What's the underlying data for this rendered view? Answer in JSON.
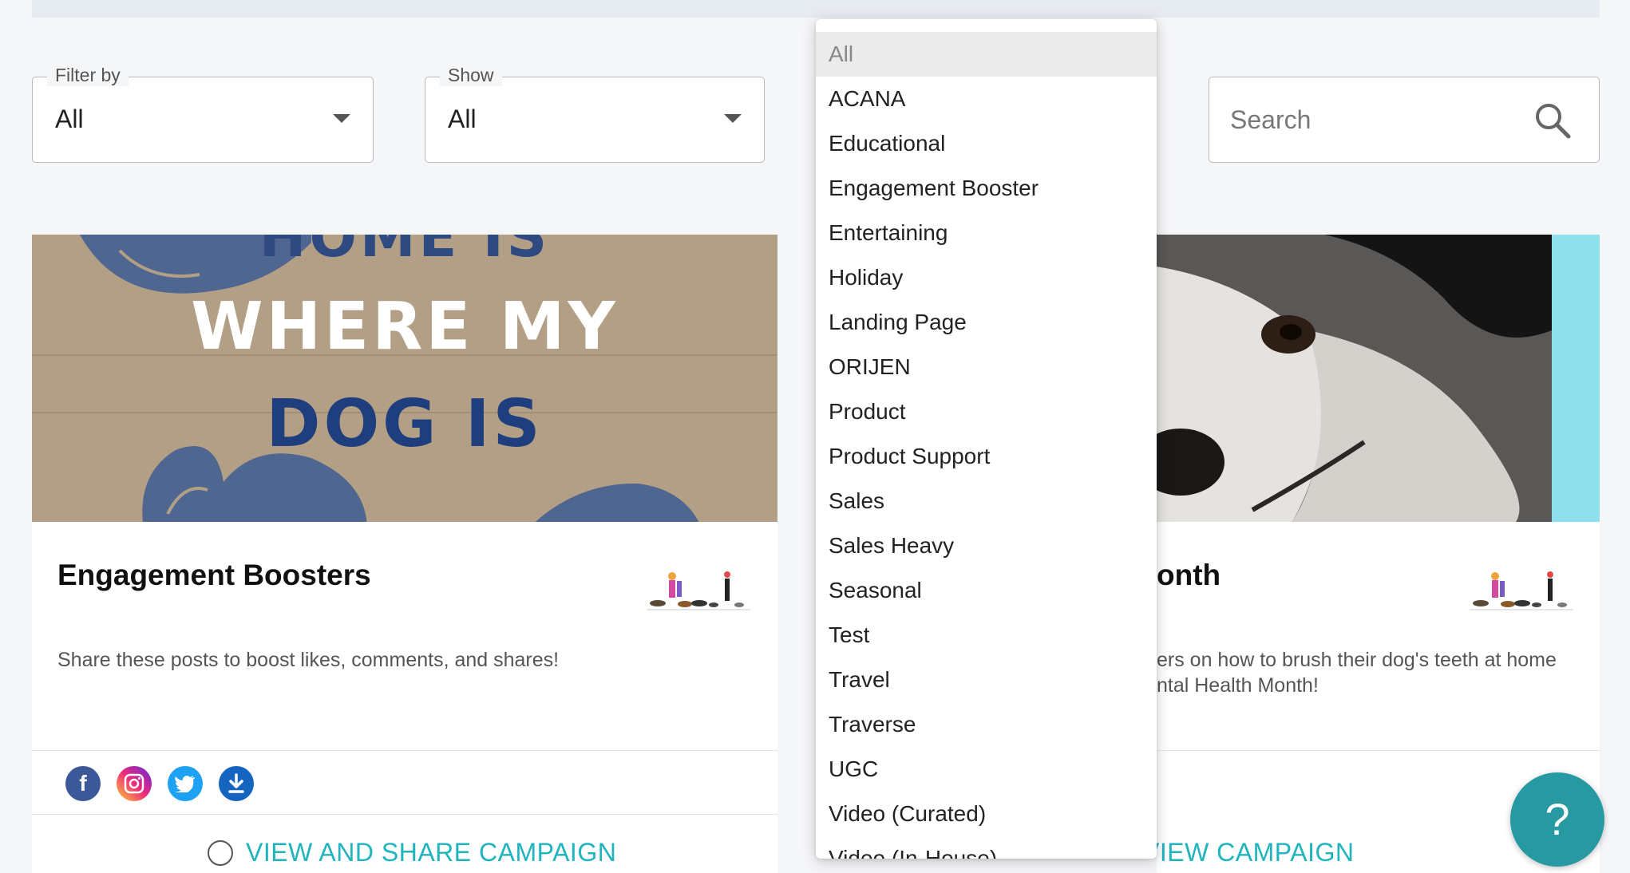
{
  "filters": {
    "filter_by": {
      "label": "Filter by",
      "value": "All"
    },
    "show": {
      "label": "Show",
      "value": "All"
    }
  },
  "search": {
    "placeholder": "Search"
  },
  "dropdown": {
    "options": [
      "All",
      "ACANA",
      "Educational",
      "Engagement Booster",
      "Entertaining",
      "Holiday",
      "Landing Page",
      "ORIJEN",
      "Product",
      "Product Support",
      "Sales",
      "Sales Heavy",
      "Seasonal",
      "Test",
      "Travel",
      "Traverse",
      "UGC",
      "Video (Curated)",
      "Video (In-House)"
    ],
    "selected": "All"
  },
  "cards": [
    {
      "poster_lines": [
        "HOME IS",
        "WHERE MY",
        "DOG IS"
      ],
      "title": "Engagement Boosters",
      "description": "Share these posts to boost likes, comments, and shares!",
      "social_icons": [
        "facebook-icon",
        "instagram-icon",
        "twitter-icon",
        "download-icon"
      ],
      "cta": "VIEW AND SHARE CAMPAIGN"
    },
    {
      "title": "onth",
      "description_lines": [
        "ers on how to brush their dog's teeth at home",
        "ntal Health Month!"
      ],
      "cta": "VIEW CAMPAIGN"
    }
  ],
  "help": {
    "label": "?"
  },
  "colors": {
    "accent": "#20b4bf",
    "help_button": "#2699a2",
    "facebook": "#3b5998",
    "twitter": "#1da1f2",
    "download": "#1565c0",
    "status_green": "#8bd86a"
  }
}
